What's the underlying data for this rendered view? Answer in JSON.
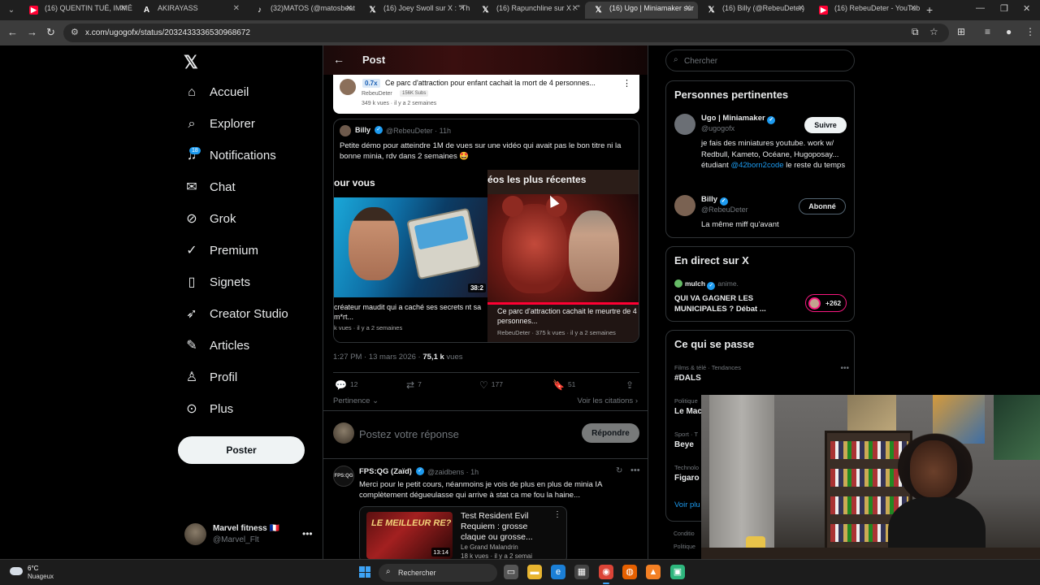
{
  "browser": {
    "tabs": [
      {
        "title": "(16) QUENTIN TUÉ, IMMÉ",
        "favicon": "youtube-icon"
      },
      {
        "title": "AKIRAYASS",
        "favicon": "a-icon"
      },
      {
        "title": "(32)MATOS (@matosbeat",
        "favicon": "tiktok-icon"
      },
      {
        "title": "(16) Joey Swoll sur X : \"Th",
        "favicon": "x-icon"
      },
      {
        "title": "(16) Rapunchline sur X : \"",
        "favicon": "x-icon"
      },
      {
        "title": "(16) Ugo | Miniamaker sur",
        "favicon": "x-icon"
      },
      {
        "title": "(16) Billy (@RebeuDeter)",
        "favicon": "x-icon"
      },
      {
        "title": "(16) RebeuDeter - YouTub",
        "favicon": "youtube-icon"
      }
    ],
    "active_tab": 5,
    "url": "x.com/ugogofx/status/2032433336530968672"
  },
  "nav": {
    "items": [
      {
        "label": "Accueil",
        "icon": "home-icon"
      },
      {
        "label": "Explorer",
        "icon": "search-icon"
      },
      {
        "label": "Notifications",
        "icon": "bell-icon"
      },
      {
        "label": "Chat",
        "icon": "mail-icon"
      },
      {
        "label": "Grok",
        "icon": "grok-icon"
      },
      {
        "label": "Premium",
        "icon": "x-premium-icon"
      },
      {
        "label": "Signets",
        "icon": "bookmark-icon"
      },
      {
        "label": "Creator Studio",
        "icon": "rocket-icon"
      },
      {
        "label": "Articles",
        "icon": "article-icon"
      },
      {
        "label": "Profil",
        "icon": "person-icon"
      },
      {
        "label": "Plus",
        "icon": "more-circle-icon"
      }
    ],
    "notification_badge": "18",
    "post_button": "Poster",
    "account": {
      "name": "Marvel fitness 🇫🇷",
      "handle": "@Marvel_Flt"
    }
  },
  "post": {
    "header_title": "Post",
    "yt_card": {
      "speed": "0.7x",
      "title": "Ce parc d'attraction pour enfant cachait la mort de 4 personnes...",
      "channel": "RebeuDeter",
      "subs": "156K Subs",
      "meta": "349 k vues · il y a 2 semaines"
    },
    "quote": {
      "name": "Billy",
      "handle": "@RebeuDeter · 11h",
      "text": "Petite démo pour atteindre 1M de vues sur une vidéo qui avait pas le bon titre ni la bonne minia, rdv dans 2 semaines 🤩",
      "left_thumb": {
        "header": "our vous",
        "duration": "38:2",
        "caption": "créateur maudit qui a caché ses secrets nt sa m*rt...",
        "meta": "k vues · il y a 2 semaines"
      },
      "right_thumb": {
        "header": "éos les plus récentes",
        "caption": "Ce parc d'attraction cachait le meurtre de 4 personnes...",
        "meta": "RebeuDeter · 375 k vues · il y a 2 semaines"
      }
    },
    "timestamp": "1:27 PM · 13 mars 2026 · ",
    "views": "75,1 k",
    "views_suffix": " vues",
    "stats": {
      "replies": "12",
      "reposts": "7",
      "likes": "177",
      "bookmarks": "51"
    },
    "sort_label": "Pertinence",
    "citations_label": "Voir les citations",
    "reply_placeholder": "Postez votre réponse",
    "reply_button": "Répondre",
    "reply": {
      "avatar_text": "FPS:QG",
      "name": "FPS:QG (Zaïd)",
      "handle": "@zaidbens · 1h",
      "text": "Merci pour le petit cours, néanmoins je vois de plus en plus de minia IA complètement dégueulasse qui arrive à stat ca me fou la haine...",
      "embed": {
        "thumb_text": "LE MEILLEUR RE?",
        "duration": "13:14",
        "title": "Test Resident Evil Requiem : grosse claque ou grosse...",
        "channel": "Le Grand Malandrin",
        "meta": "18 k vues · il y a 2 semai"
      }
    }
  },
  "sidebar": {
    "search_placeholder": "Chercher",
    "relevant": {
      "title": "Personnes pertinentes",
      "people": [
        {
          "name": "Ugo | Miniamaker",
          "handle": "@ugogofx",
          "bio_before": "je fais des miniatures youtube. work w/ Redbull, Kameto, Océane, Hugoposay... étudiant ",
          "bio_link": "@42born2code",
          "bio_after": " le reste du temps",
          "button": "Suivre"
        },
        {
          "name": "Billy",
          "handle": "@RebeuDeter",
          "bio": "La même miff qu'avant",
          "button": "Abonné"
        }
      ]
    },
    "live": {
      "title": "En direct sur X",
      "user": "mulch",
      "status": "anime.",
      "headline": "QUI VA GAGNER LES MUNICIPALES ? Débat ...",
      "count": "+262"
    },
    "trends": {
      "title": "Ce qui se passe",
      "items": [
        {
          "category": "Films & télé · Tendances",
          "name": "#DALS"
        },
        {
          "category": "Politique",
          "name": "Le Mac"
        },
        {
          "category": "Sport · T",
          "name": "Beye"
        },
        {
          "category": "Technolo",
          "name": "Figaro"
        }
      ],
      "more": "Voir plu"
    },
    "legal": [
      "Conditio",
      "Politique"
    ]
  },
  "taskbar": {
    "temperature": "6°C",
    "weather": "Nuageux",
    "search": "Rechercher"
  },
  "colors": {
    "accent": "#1d9bf0",
    "live": "#f91880",
    "youtube": "#ff0033"
  }
}
